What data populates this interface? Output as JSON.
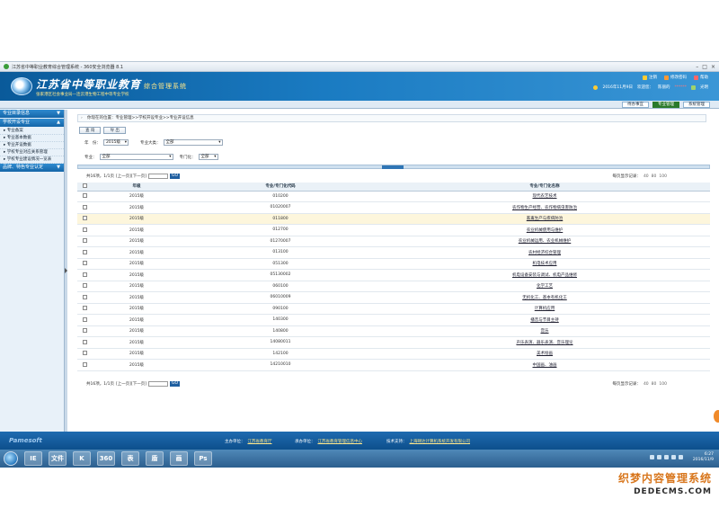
{
  "window": {
    "title": "江苏省中等职业教育综合管理系统 - 360安全浏览器 8.1",
    "controls": [
      "–",
      "□",
      "×"
    ]
  },
  "header": {
    "brand": "江苏省中等职业教育",
    "brand_sub": "综合管理系统",
    "unit": "张家港区社会事业局—连云港生物工程中等专业学校",
    "links": {
      "logout": "注销",
      "change_pwd": "修改密码",
      "help": "帮助"
    },
    "date": "2016年11月9日",
    "welcome": "欢迎您：",
    "user": "陈丽的",
    "user_extra": "******",
    "role": "光明"
  },
  "nav": {
    "tabs": [
      "待办事宜",
      "专业管理",
      "系统管理"
    ],
    "active": "专业管理"
  },
  "sidebar": {
    "sections": [
      {
        "label": "专业目录信息",
        "arrow": "▼"
      },
      {
        "label": "学校开设专业",
        "arrow": "▲"
      }
    ],
    "items": [
      "专业备案",
      "专业基本数据",
      "专业开设数据",
      "学校专业对应关系管理",
      "学校专业建设情况一览表"
    ],
    "section3": {
      "label": "品牌、特色专业认定",
      "arrow": "▼"
    }
  },
  "breadcrumb": "你现在的位置：专业管理>>学校开设专业>>专业开设信息",
  "toolbar": {
    "query": "查 询",
    "export": "导 出"
  },
  "filters": {
    "year_label": "年　份：",
    "year_value": "2015级",
    "category_label": "专业大类：",
    "category_value": "全部",
    "major_label": "专业：",
    "major_value": "全部",
    "door_label": "专门化：",
    "door_value": "全部"
  },
  "pager": {
    "summary": "共16项，1/1页",
    "nav": "[上一页][下一页]",
    "go": "GO",
    "pagesize_label": "每页显示记录：",
    "options": [
      "40",
      "80",
      "100"
    ]
  },
  "table": {
    "headers": [
      "年级",
      "专业/专门化代码",
      "专业/专门化名称"
    ],
    "rows": [
      {
        "year": "2015级",
        "code": "010200",
        "name": "现代农艺技术"
      },
      {
        "year": "2015级",
        "code": "01020007",
        "name": "农作物生产经营、农作物病虫害防治"
      },
      {
        "year": "2015级",
        "code": "011800",
        "name": "畜禽生产与疾病防治"
      },
      {
        "year": "2015级",
        "code": "012700",
        "name": "农业机械使用与维护"
      },
      {
        "year": "2015级",
        "code": "01270007",
        "name": "农业机械运用、农业机械维护"
      },
      {
        "year": "2015级",
        "code": "013100",
        "name": "农村经济综合管理"
      },
      {
        "year": "2015级",
        "code": "051300",
        "name": "机电技术应用"
      },
      {
        "year": "2015级",
        "code": "05130002",
        "name": "机电设备安装与调试、机电产品维修"
      },
      {
        "year": "2015级",
        "code": "060100",
        "name": "化学工艺"
      },
      {
        "year": "2015级",
        "code": "06010009",
        "name": "无机化工、基本有机化工"
      },
      {
        "year": "2015级",
        "code": "090100",
        "name": "计算机应用"
      },
      {
        "year": "2015级",
        "code": "140300",
        "name": "播音与节目主持"
      },
      {
        "year": "2015级",
        "code": "140800",
        "name": "音乐"
      },
      {
        "year": "2015级",
        "code": "14080011",
        "name": "声乐表演、器乐表演、音乐理论"
      },
      {
        "year": "2015级",
        "code": "142100",
        "name": "美术绘画"
      },
      {
        "year": "2015级",
        "code": "14210010",
        "name": "中国画、油画"
      }
    ]
  },
  "footer": {
    "brand": "Pamesoft",
    "sponsor_label": "主办单位：",
    "sponsor": "江苏省教育厅",
    "organizer_label": "承办单位：",
    "organizer": "江苏省教育管理信息中心",
    "support_label": "技术支持：",
    "support": "上海颐达计算机系统开发有限公司"
  },
  "taskbar": {
    "apps": [
      "IE",
      "文件",
      "K",
      "360",
      "表",
      "盾",
      "画",
      "Ps"
    ],
    "time": "6:27",
    "date": "2016/11/9"
  },
  "watermark": {
    "line1": "织梦内容管理系统",
    "line2": "DEDECMS.COM"
  }
}
